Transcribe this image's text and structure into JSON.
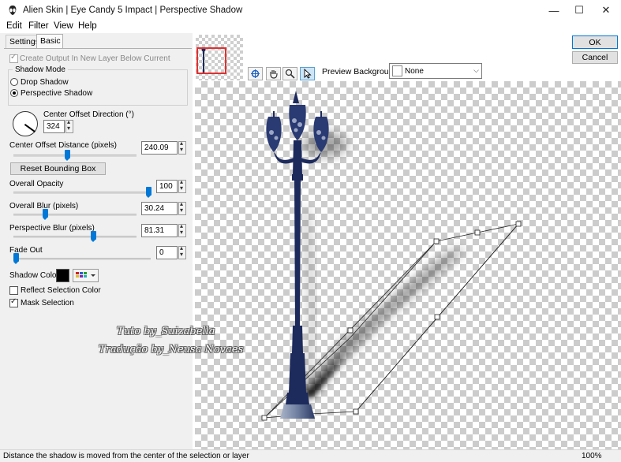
{
  "window": {
    "title": "Alien Skin | Eye Candy 5 Impact | Perspective Shadow",
    "controls": [
      "—",
      "☐",
      "✕"
    ]
  },
  "menu": [
    "Edit",
    "Filter",
    "View",
    "Help"
  ],
  "tabs": [
    "Settings",
    "Basic"
  ],
  "basic": {
    "create_output_label": "Create Output In New Layer Below Current",
    "create_output_checked": true,
    "shadow_mode_title": "Shadow Mode",
    "shadow_modes": [
      "Drop Shadow",
      "Perspective Shadow"
    ],
    "shadow_mode_selected": "Perspective Shadow",
    "direction_label": "Center Offset Direction (°)",
    "direction_value": "324",
    "distance_label": "Center Offset Distance (pixels)",
    "distance_value": "240.09",
    "reset_button": "Reset Bounding Box",
    "opacity_label": "Overall Opacity",
    "opacity_value": "100",
    "blur_label": "Overall Blur (pixels)",
    "blur_value": "30.24",
    "persp_blur_label": "Perspective Blur (pixels)",
    "persp_blur_value": "81.31",
    "fade_label": "Fade Out",
    "fade_value": "0",
    "shadow_color_label": "Shadow Color",
    "shadow_color": "#000000",
    "reflect_label": "Reflect Selection Color",
    "reflect_checked": false,
    "mask_label": "Mask Selection",
    "mask_checked": true
  },
  "preview": {
    "background_label": "Preview Background:",
    "background_value": "None",
    "tools": [
      "navigate-icon",
      "hand-icon",
      "zoom-icon",
      "pointer-icon"
    ]
  },
  "buttons": {
    "ok": "OK",
    "cancel": "Cancel"
  },
  "watermark": {
    "line1": "Tuto by_Suizabella",
    "line2": "Tradução by_Neusa Novaes"
  },
  "status": {
    "text": "Distance the shadow is moved from the center of the selection or layer",
    "zoom": "100%"
  },
  "colors": {
    "accent": "#0078d7",
    "lamp": "#1d2a5c"
  }
}
